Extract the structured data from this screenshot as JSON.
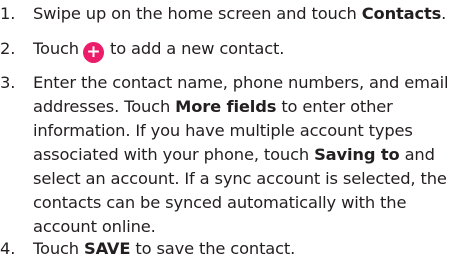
{
  "steps": [
    {
      "number": "1.",
      "parts": {
        "a": "Swipe up on the home screen and touch ",
        "b": "Contacts",
        "c": "."
      }
    },
    {
      "number": "2.",
      "parts": {
        "a": "Touch",
        "icon": "plus-icon",
        "c": "to add a new contact."
      }
    },
    {
      "number": "3.",
      "lines": [
        {
          "a": "Enter the contact name, phone numbers, and email"
        },
        {
          "a": "addresses. Touch ",
          "b": "More fields",
          "c": " to enter other"
        },
        {
          "a": "information. If you have multiple account types"
        },
        {
          "a": "associated with your phone, touch ",
          "b": "Saving to",
          "c": " and"
        },
        {
          "a": "select an account. If a sync account is selected, the"
        },
        {
          "a": "contacts can be synced automatically with the"
        },
        {
          "a": "account online."
        }
      ]
    },
    {
      "number": "4.",
      "parts": {
        "a": "Touch ",
        "b": "SAVE",
        "c": " to save the contact."
      }
    }
  ],
  "colors": {
    "text": "#231f20",
    "accent": "#ec1c6b"
  }
}
